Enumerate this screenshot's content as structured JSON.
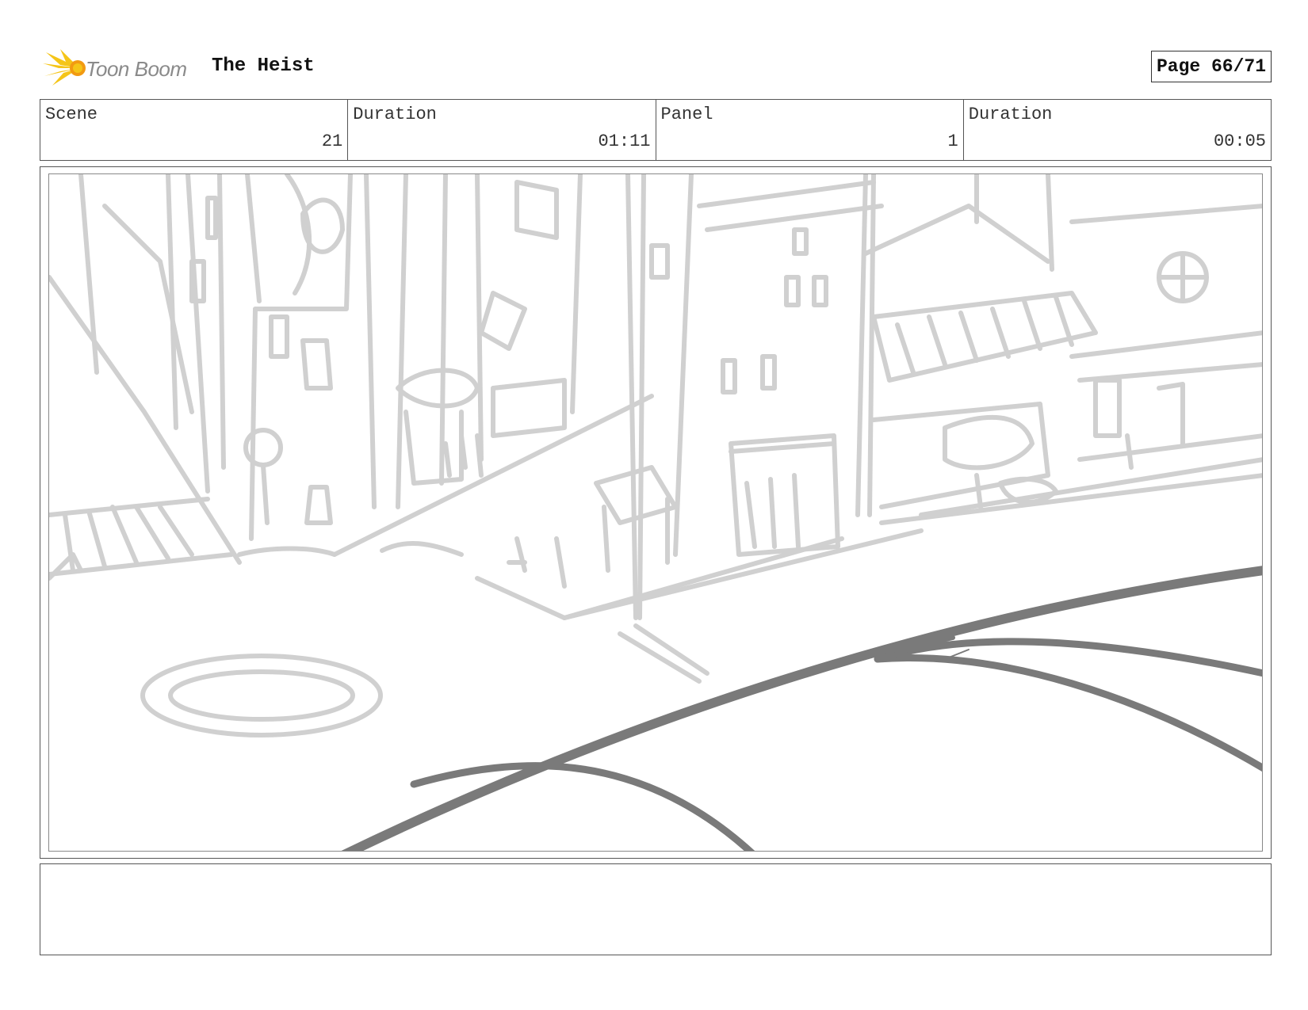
{
  "header": {
    "logo_text": "Toon Boom",
    "project_title": "The Heist",
    "page_label": "Page 66/71"
  },
  "info": {
    "scene_label": "Scene",
    "scene_value": "21",
    "scene_duration_label": "Duration",
    "scene_duration_value": "01:11",
    "panel_label": "Panel",
    "panel_value": "1",
    "panel_duration_label": "Duration",
    "panel_duration_value": "00:05"
  },
  "sketch": {
    "icon": "storyboard-sketch-city-street",
    "light_stroke": "#d0d0d0",
    "dark_stroke": "#7a7a7a"
  },
  "notes": {
    "text": ""
  },
  "colors": {
    "logo_yellow": "#f5c518",
    "logo_orange": "#f29a12",
    "border": "#555555"
  }
}
